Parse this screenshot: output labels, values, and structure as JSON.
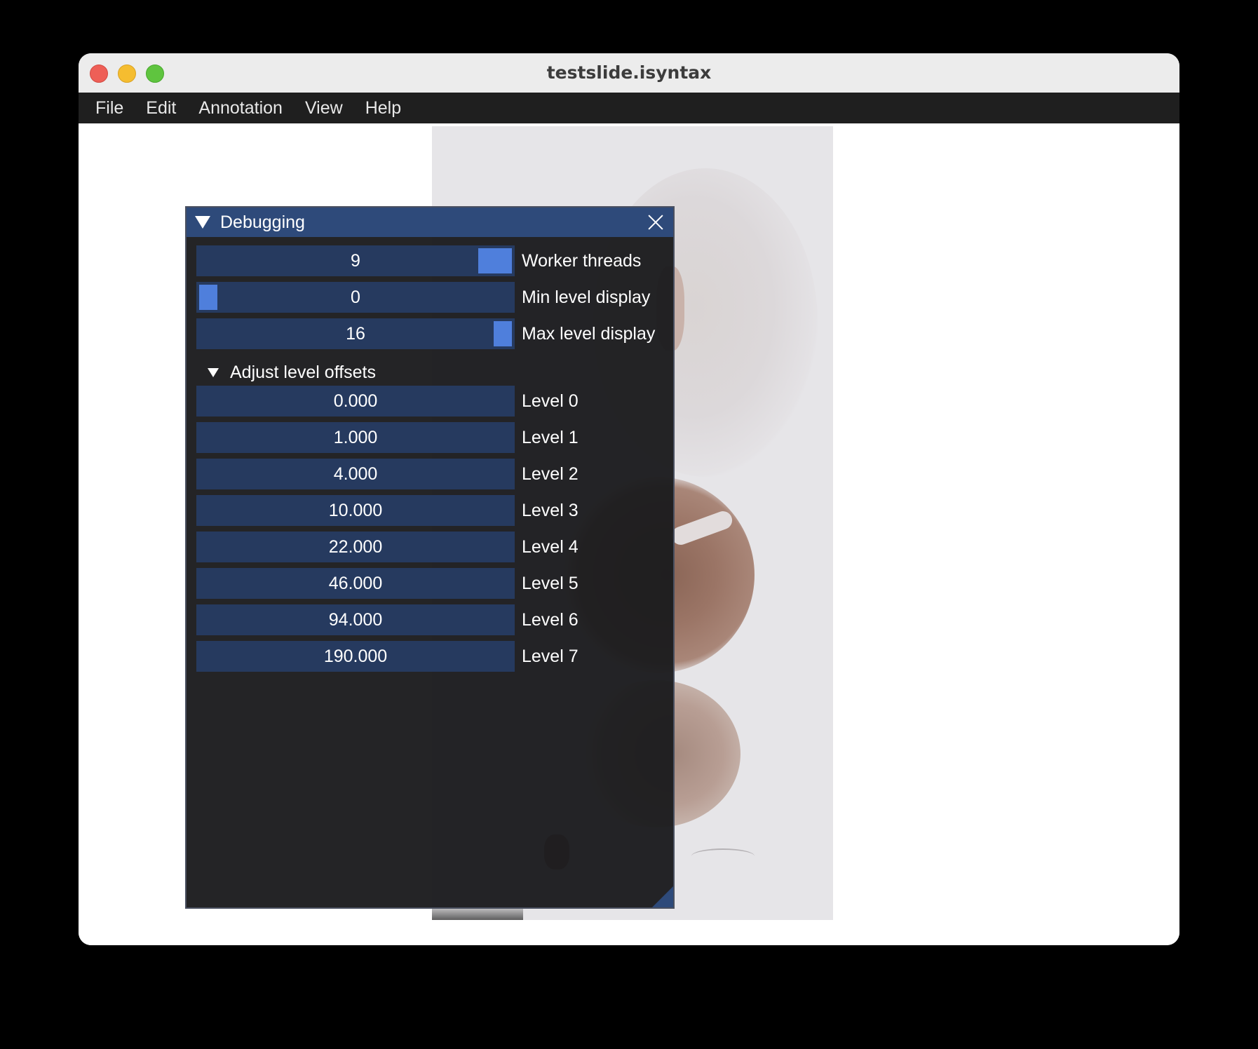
{
  "window": {
    "title": "testslide.isyntax"
  },
  "menubar": {
    "items": [
      "File",
      "Edit",
      "Annotation",
      "View",
      "Help"
    ]
  },
  "panel": {
    "title": "Debugging",
    "sliders": [
      {
        "label": "Worker threads",
        "value": "9"
      },
      {
        "label": "Min level display",
        "value": "0"
      },
      {
        "label": "Max level display",
        "value": "16"
      }
    ],
    "tree_node": {
      "label": "Adjust level offsets"
    },
    "levels": [
      {
        "label": "Level 0",
        "value": "0.000"
      },
      {
        "label": "Level 1",
        "value": "1.000"
      },
      {
        "label": "Level 2",
        "value": "4.000"
      },
      {
        "label": "Level 3",
        "value": "10.000"
      },
      {
        "label": "Level 4",
        "value": "22.000"
      },
      {
        "label": "Level 5",
        "value": "46.000"
      },
      {
        "label": "Level 6",
        "value": "94.000"
      },
      {
        "label": "Level 7",
        "value": "190.000"
      }
    ]
  },
  "colors": {
    "header": "#2e4a7a",
    "field": "#263a5f",
    "grab": "#4f7fdc",
    "menubar": "#1f1f1f"
  }
}
